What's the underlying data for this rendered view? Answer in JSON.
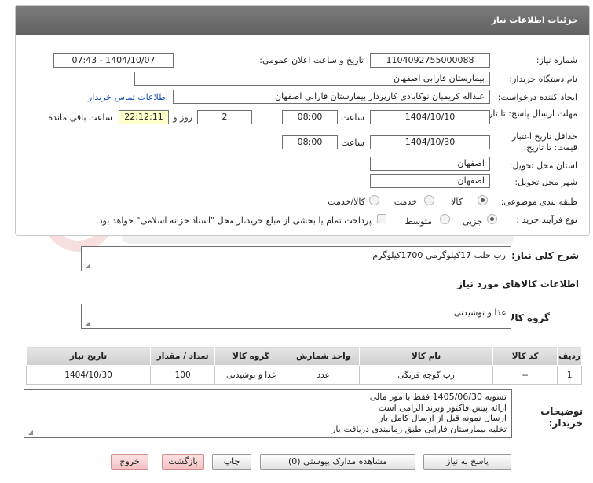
{
  "header": {
    "title": "جزئیات اطلاعات نیاز"
  },
  "form": {
    "need_number_label": "شماره نیاز:",
    "need_number": "1104092755000088",
    "announce_label": "تاریخ و ساعت اعلان عمومی:",
    "announce_value": "1404/10/07 - 07:43",
    "buyer_org_label": "نام دستگاه خریدار:",
    "buyer_org": "بیمارستان فارابی اصفهان",
    "creator_label": "ایجاد کننده درخواست:",
    "creator": "عبداله کریمیان نوکابادی کارپرداز بیمارستان فارابی اصفهان",
    "contact_link": "اطلاعات تماس خریدار",
    "reply_deadline_label": "مهلت ارسال پاسخ: تا تاریخ:",
    "reply_date": "1404/10/10",
    "time_label": "ساعت",
    "reply_time": "08:00",
    "days_value": "2",
    "days_label": "روز و",
    "remaining_time": "22:12:11",
    "remaining_label": "ساعت باقی مانده",
    "validity_label": "حداقل تاریخ اعتبار قیمت: تا تاریخ:",
    "validity_date": "1404/10/30",
    "validity_time": "08:00",
    "province_label": "استان محل تحویل:",
    "province": "اصفهان",
    "city_label": "شهر محل تحویل:",
    "city": "اصفهان",
    "category_label": "طبقه بندی موضوعی:",
    "category_options": [
      "کالا",
      "خدمت",
      "کالا/خدمت"
    ],
    "process_label": "نوع فرآیند خرید :",
    "process_options": [
      "جزیی",
      "متوسط"
    ],
    "payment_note": "پرداخت تمام یا بخشی از مبلغ خرید،از محل \"اسناد خزانه اسلامی\" خواهد بود."
  },
  "summary": {
    "label": "شرح کلی نیاز:",
    "value": "رب حلب 17کیلوگرمی 1700کیلوگرم"
  },
  "goods": {
    "section_title": "اطلاعات کالاهای مورد نیاز",
    "group_label": "گروه کالا:",
    "group_value": "غذا و نوشیدنی"
  },
  "table": {
    "headers": [
      "ردیف",
      "کد کالا",
      "نام کالا",
      "واحد شمارش",
      "گروه کالا",
      "تعداد / مقدار",
      "تاریخ نیاز"
    ],
    "rows": [
      [
        "1",
        "--",
        "رب گوجه فرنگی",
        "عدد",
        "غذا و نوشیدنی",
        "100",
        "1404/10/30"
      ]
    ]
  },
  "notes": {
    "label": "توضیحات خریدار:",
    "lines": [
      "تسویه 1405/06/30 فقط باامور مالی",
      "ارائه پیش فاکتور وبرند الزامی است",
      "ارسال نمونه قبل از ارسال کامل بار",
      "تخلیه بیمارستان فارابی طبق زمانبندی دریافت بار"
    ]
  },
  "buttons": {
    "reply": "پاسخ به نیاز",
    "view_docs": "مشاهده مدارک پیوستی (0)",
    "print": "چاپ",
    "back": "بازگشت",
    "exit": "خروج"
  }
}
